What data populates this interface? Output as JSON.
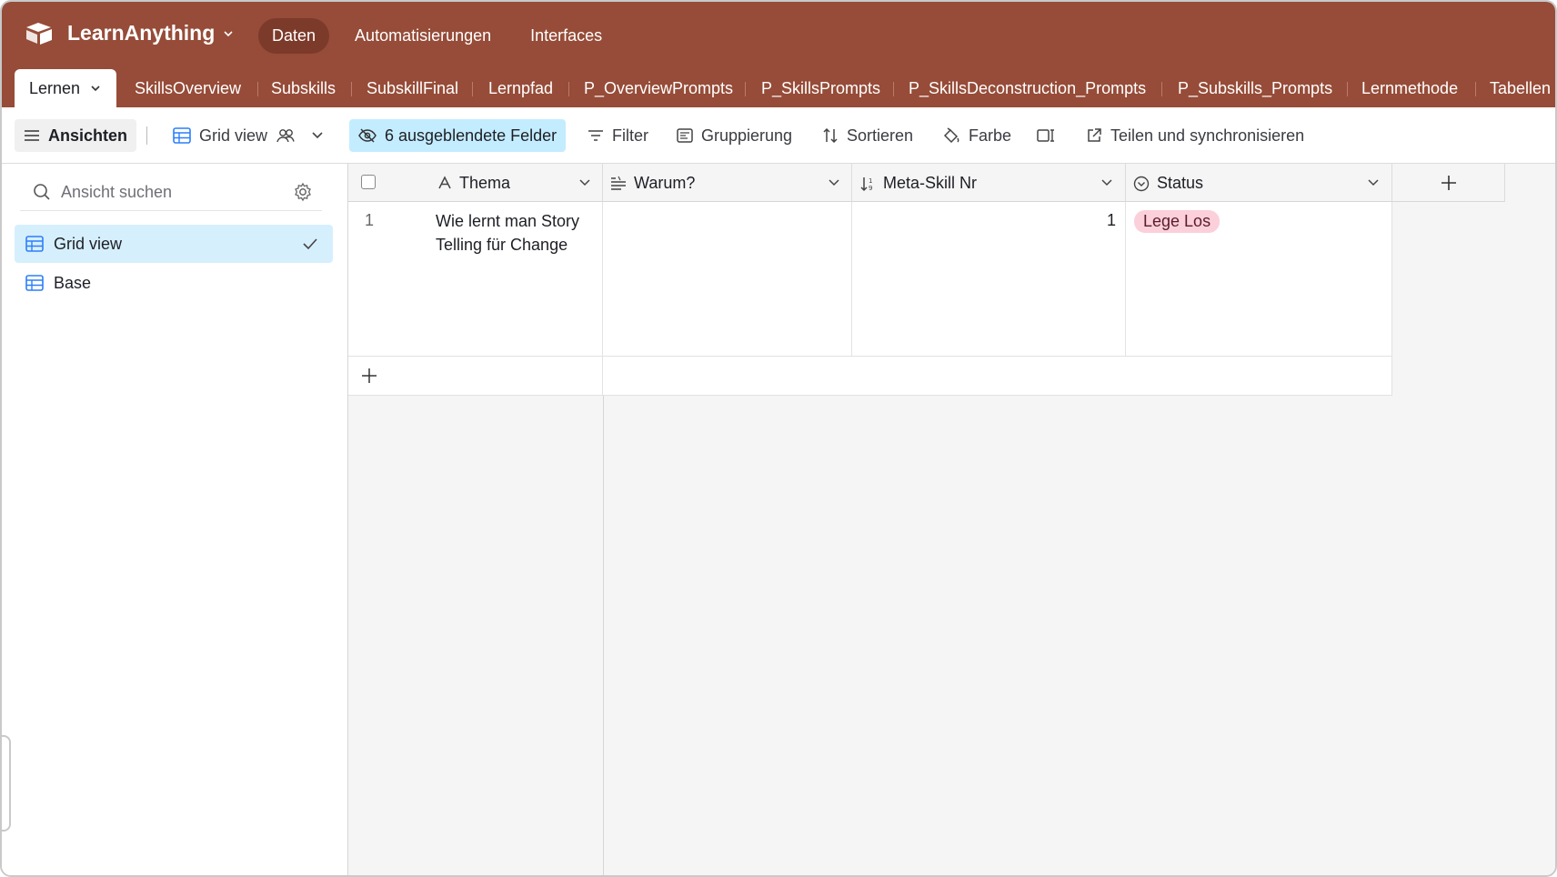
{
  "app": {
    "base_name": "LearnAnything",
    "nav": [
      {
        "label": "Daten",
        "active": true
      },
      {
        "label": "Automatisierungen",
        "active": false
      },
      {
        "label": "Interfaces",
        "active": false
      }
    ],
    "topbar_color": "#964c38"
  },
  "tables": {
    "active": "Lernen",
    "items": [
      "SkillsOverview",
      "Subskills",
      "SubskillFinal",
      "Lernpfad",
      "P_OverviewPrompts",
      "P_SkillsPrompts",
      "P_SkillsDeconstruction_Prompts",
      "P_Subskills_Prompts",
      "Lernmethode",
      "Tabellen"
    ]
  },
  "toolbar": {
    "views_label": "Ansichten",
    "view_name": "Grid view",
    "hidden_fields": "6 ausgeblendete Felder",
    "filter": "Filter",
    "group": "Gruppierung",
    "sort": "Sortieren",
    "color": "Farbe",
    "share": "Teilen und synchronisieren"
  },
  "sidebar": {
    "search_placeholder": "Ansicht suchen",
    "views": [
      {
        "label": "Grid view",
        "selected": true
      },
      {
        "label": "Base",
        "selected": false
      }
    ]
  },
  "grid": {
    "columns": [
      {
        "label": "Thema",
        "icon": "text-field-icon"
      },
      {
        "label": "Warum?",
        "icon": "long-text-icon"
      },
      {
        "label": "Meta-Skill Nr",
        "icon": "number-field-icon"
      },
      {
        "label": "Status",
        "icon": "single-select-icon"
      }
    ],
    "rows": [
      {
        "index": "1",
        "thema": "Wie lernt man Story Telling für Change",
        "warum": "",
        "meta_skill_nr": "1",
        "status": "Lege Los"
      }
    ],
    "status_color": "#fbd0db"
  }
}
